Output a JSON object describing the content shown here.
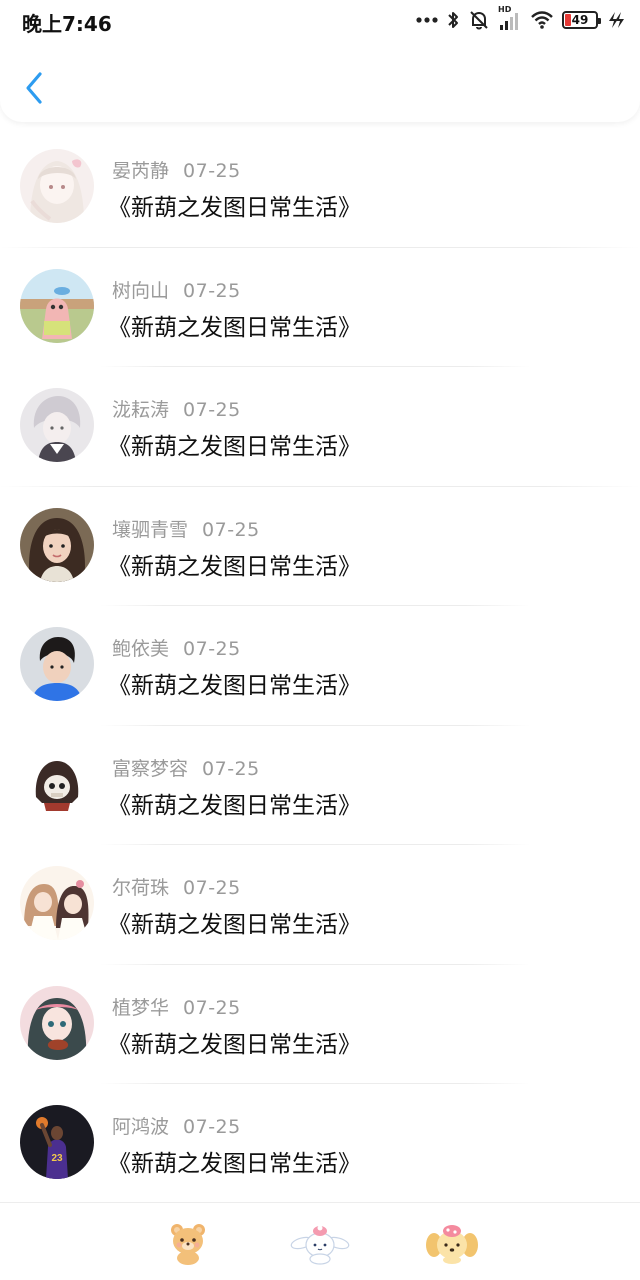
{
  "status_bar": {
    "time": "晚上7:46",
    "network_label": "HD",
    "battery_level": "49",
    "icons": [
      "dots-icon",
      "bluetooth-icon",
      "mute-icon",
      "signal-icon",
      "wifi-icon",
      "battery-icon",
      "charging-icon"
    ]
  },
  "nav": {
    "back_icon": "chevron-left-icon",
    "accent_color": "#2d9cf0"
  },
  "comments": [
    {
      "name": "晏芮静",
      "date": "07-25",
      "text": "《新葫之发图日常生活》",
      "avatar": "anime-girl-avatar"
    },
    {
      "name": "树向山",
      "date": "07-25",
      "text": "《新葫之发图日常生活》",
      "avatar": "cartoon-starfish-avatar"
    },
    {
      "name": "泷耘涛",
      "date": "07-25",
      "text": "《新葫之发图日常生活》",
      "avatar": "anime-boy-avatar"
    },
    {
      "name": "壤驷青雪",
      "date": "07-25",
      "text": "《新葫之发图日常生活》",
      "avatar": "girl-photo-avatar"
    },
    {
      "name": "鲍依美",
      "date": "07-25",
      "text": "《新葫之发图日常生活》",
      "avatar": "boy-photo-avatar"
    },
    {
      "name": "富察梦容",
      "date": "07-25",
      "text": "《新葫之发图日常生活》",
      "avatar": "skull-hood-avatar"
    },
    {
      "name": "尔荷珠",
      "date": "07-25",
      "text": "《新葫之发图日常生活》",
      "avatar": "anime-pair-avatar"
    },
    {
      "name": "植梦华",
      "date": "07-25",
      "text": "《新葫之发图日常生活》",
      "avatar": "anime-violin-avatar"
    },
    {
      "name": "阿鸿波",
      "date": "07-25",
      "text": "《新葫之发图日常生活》",
      "avatar": "basketball-player-avatar"
    }
  ],
  "tabs": [
    {
      "icon": "bear-icon"
    },
    {
      "icon": "bunny-icon"
    },
    {
      "icon": "dog-icon"
    }
  ]
}
